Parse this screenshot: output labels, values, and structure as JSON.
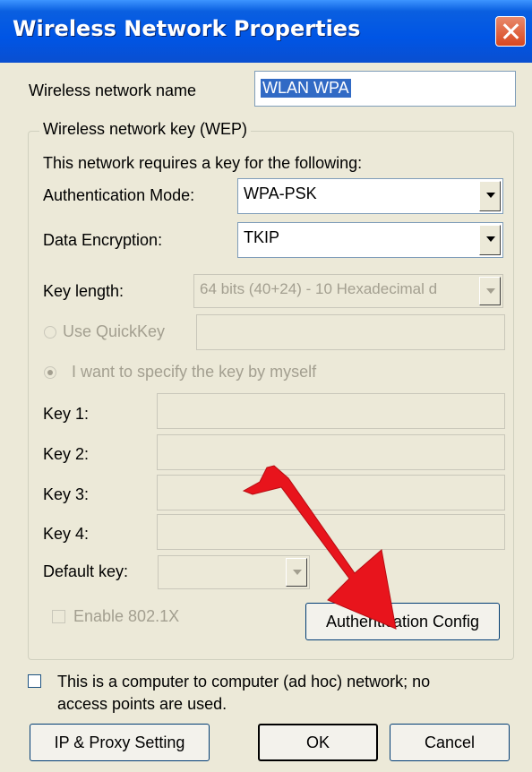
{
  "window": {
    "title": "Wireless Network Properties"
  },
  "network_name": {
    "label": "Wireless network name",
    "value": "WLAN WPA"
  },
  "group": {
    "title": "Wireless network key (WEP)",
    "intro": "This network requires a key for the following:"
  },
  "auth_mode": {
    "label": "Authentication Mode:",
    "value": "WPA-PSK"
  },
  "data_encryption": {
    "label": "Data Encryption:",
    "value": "TKIP"
  },
  "key_length": {
    "label": "Key length:",
    "value": "64 bits (40+24) - 10 Hexadecimal d"
  },
  "quickkey": {
    "label": "Use QuickKey"
  },
  "specify_key": {
    "label": "I want to specify the key by myself"
  },
  "keys": [
    {
      "label": "Key 1:"
    },
    {
      "label": "Key 2:"
    },
    {
      "label": "Key 3:"
    },
    {
      "label": "Key 4:"
    }
  ],
  "default_key": {
    "label": "Default key:"
  },
  "enable_8021x": {
    "label": "Enable 802.1X"
  },
  "auth_config_button": {
    "label": "Authentication Config"
  },
  "adhoc": {
    "label_line1": "This is a computer to computer (ad hoc) network; no",
    "label_line2": "access points are used."
  },
  "buttons": {
    "proxy": "IP & Proxy Setting",
    "ok": "OK",
    "cancel": "Cancel"
  },
  "annotation": {
    "arrow_color": "#e8141c"
  }
}
